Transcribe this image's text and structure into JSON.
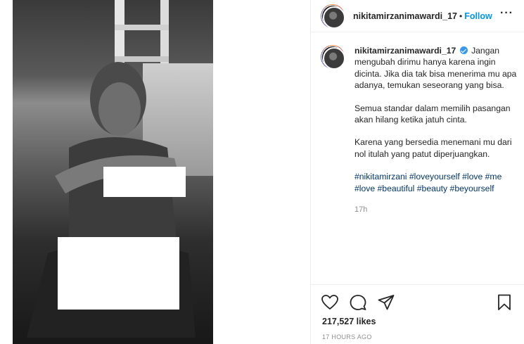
{
  "post": {
    "username": "nikitamirzanimawardi_17",
    "follow_label": "Follow",
    "dot": "•",
    "more_label": "···",
    "caption_paragraphs": [
      "Jangan mengubah dirimu hanya karena ingin dicinta. Jika dia tak bisa menerima mu apa adanya, temukan seseorang yang bisa.",
      "Semua standar dalam memilih pasangan akan hilang ketika jatuh cinta.",
      "Karena yang bersedia menemani mu dari nol itulah yang patut diperjuangkan."
    ],
    "hashtags": [
      "#nikitamirzani",
      "#loveyourself",
      "#love",
      "#me",
      "#love",
      "#beautiful",
      "#beauty",
      "#beyourself"
    ],
    "time_relative": "17h",
    "likes": "217,527 likes",
    "time_ago": "17 HOURS AGO"
  },
  "icons": {
    "like": "heart-icon",
    "comment": "comment-icon",
    "share": "send-icon",
    "save": "bookmark-icon",
    "verified": "verified-badge-icon"
  },
  "colors": {
    "link": "#0095f6",
    "hashtag": "#00376b",
    "verified": "#3897f0",
    "muted": "#8e8e8e"
  }
}
